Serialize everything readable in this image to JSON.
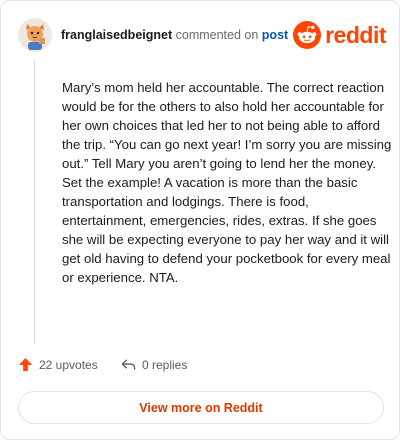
{
  "header": {
    "username": "franglaisedbeignet",
    "action_text": "commented on",
    "post_link": "post",
    "brand": "reddit",
    "brand_color": "#ff4500"
  },
  "comment": {
    "text": "Mary’s mom held her accountable. The correct reaction would be for the others to also hold her accountable for her own choices that led her to not being able to afford the trip. “You can go next year! I’m sorry you are missing out.” Tell Mary you aren’t going to lend her the money. Set the example! A vacation is more than the basic transportation and lodgings. There is food, entertainment, emergencies, rides, extras. If she goes she will be expecting everyone to pay her way and it will get old having to defend your pocketbook for every meal or experience. NTA."
  },
  "actions": {
    "upvotes": "22 upvotes",
    "replies": "0 replies",
    "upvote_icon": "upvote-arrow-icon",
    "reply_icon": "reply-arrow-icon"
  },
  "footer": {
    "button_label": "View more on Reddit",
    "button_color": "#d93a00"
  }
}
